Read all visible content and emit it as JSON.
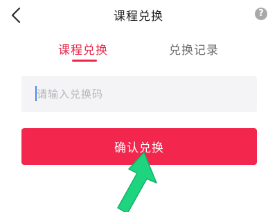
{
  "header": {
    "title": "课程兑换",
    "back_icon": "chevron-left-icon",
    "help_icon": "question-circle-icon",
    "help_glyph": "?"
  },
  "tabs": [
    {
      "label": "课程兑换",
      "active": true
    },
    {
      "label": "兑换记录",
      "active": false
    }
  ],
  "form": {
    "code_input": {
      "value": "",
      "placeholder": "请输入兑换码"
    },
    "confirm_label": "确认兑换"
  },
  "colors": {
    "accent": "#e8294c",
    "button": "#f3264d",
    "annotation_arrow": "#1fd47f"
  }
}
